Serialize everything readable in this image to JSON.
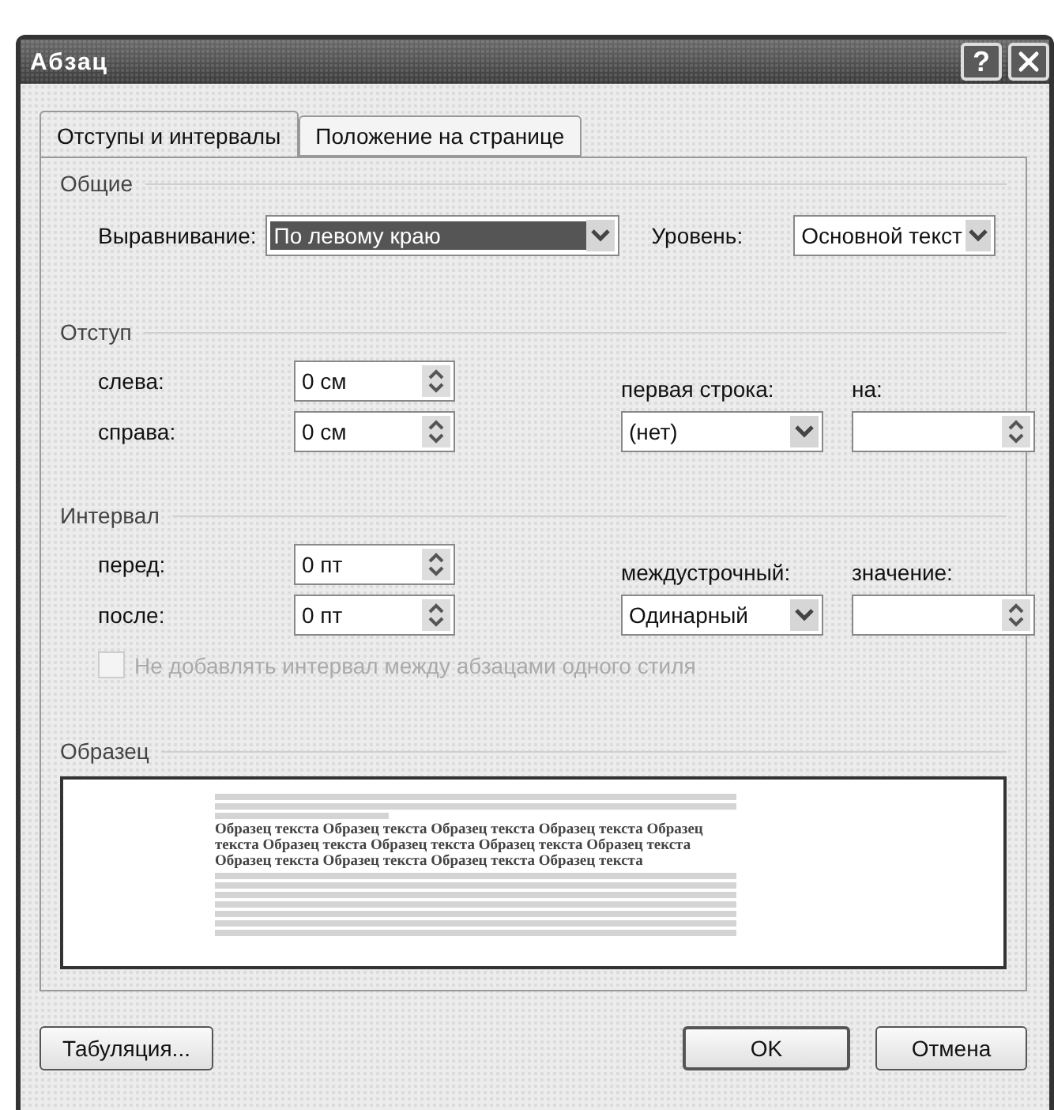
{
  "window": {
    "title": "Абзац",
    "help_button": "?"
  },
  "tabs": [
    {
      "label": "Отступы и интервалы",
      "selected": true
    },
    {
      "label": "Положение на странице",
      "selected": false
    }
  ],
  "general": {
    "heading": "Общие",
    "alignment": {
      "label": "Выравнивание:",
      "value": "По левому краю",
      "highlighted": true
    },
    "level": {
      "label": "Уровень:",
      "value": "Основной текст",
      "highlighted": false
    }
  },
  "indent": {
    "heading": "Отступ",
    "left": {
      "label": "слева:",
      "value": "0 см"
    },
    "right": {
      "label": "справа:",
      "value": "0 см"
    },
    "first_line": {
      "label": "первая строка:",
      "value": "(нет)"
    },
    "by": {
      "label": "на:"
    }
  },
  "spacing": {
    "heading": "Интервал",
    "before": {
      "label": "перед:",
      "value": "0 пт"
    },
    "after": {
      "label": "после:",
      "value": "0 пт"
    },
    "line_spacing": {
      "label": "междустрочный:",
      "value": "Одинарный"
    },
    "at": {
      "label": "значение:"
    },
    "no_space_same_style": {
      "label": "Не добавлять интервал между абзацами одного стиля",
      "checked": false,
      "disabled": true
    }
  },
  "preview": {
    "heading": "Образец",
    "sample_text": "Образец текста Образец текста Образец текста Образец текста Образец текста Образец текста Образец текста Образец текста Образец текста Образец текста Образец текста Образец текста Образец текста"
  },
  "footer": {
    "tabs_button": {
      "label": "Табуляция...",
      "default": false
    },
    "buttons": [
      {
        "label": "OK",
        "default": true
      },
      {
        "label": "Отмена",
        "default": false
      }
    ]
  }
}
